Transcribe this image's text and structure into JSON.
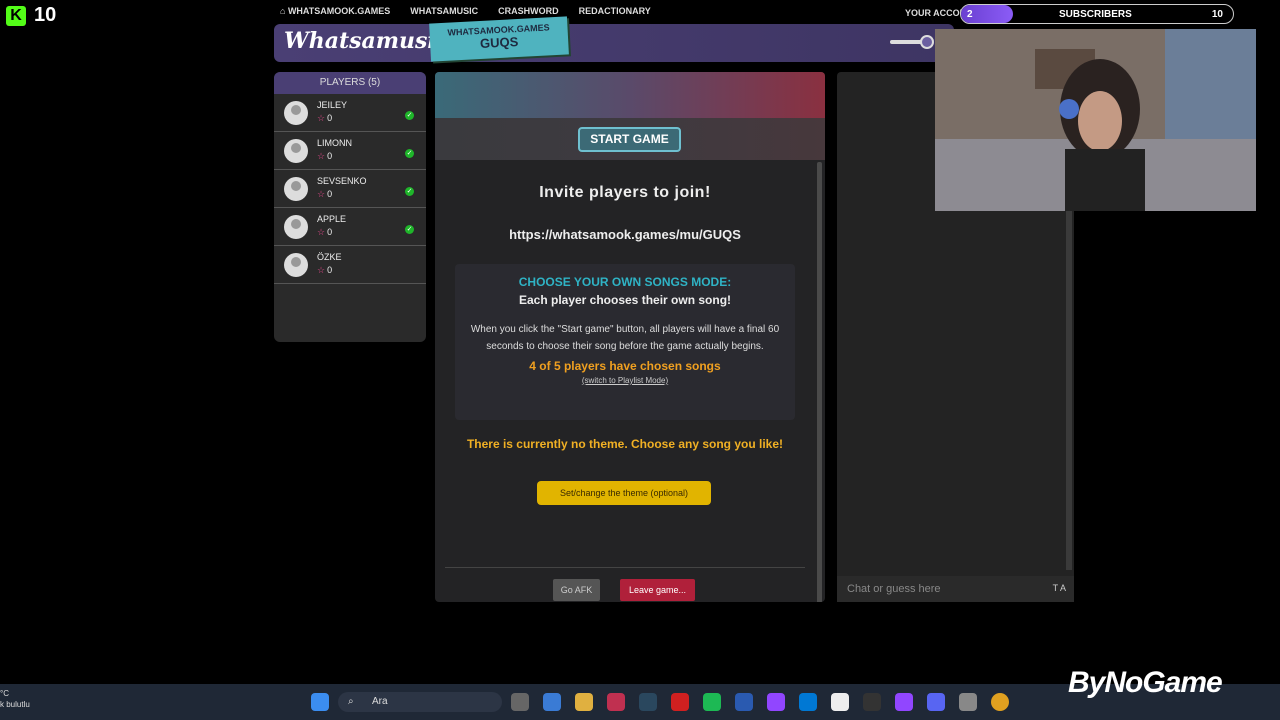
{
  "overlay": {
    "kick_count": "10",
    "subs_count": "2",
    "subs_label": "SUBSCRIBERS",
    "subs_goal": "10",
    "brand": "ByNoGame"
  },
  "topnav": {
    "items": [
      "WHATSAMOOK.GAMES",
      "WHATSAMUSIC",
      "CRASHWORD",
      "REDACTIONARY"
    ],
    "account": "YOUR ACCOU"
  },
  "header": {
    "logo": "Whatsamusic",
    "room_site": "WHATSAMOOK.GAMES",
    "room_code": "GUQS"
  },
  "players": {
    "title": "PLAYERS (5)",
    "list": [
      {
        "name": "JEILEY",
        "score": "0",
        "ready": true
      },
      {
        "name": "LIMONN",
        "score": "0",
        "ready": true
      },
      {
        "name": "SEVSENKO",
        "score": "0",
        "ready": true
      },
      {
        "name": "APPLE",
        "score": "0",
        "ready": true
      },
      {
        "name": "ÖZKE",
        "score": "0",
        "ready": false
      }
    ]
  },
  "main": {
    "start_label": "START GAME",
    "invite": "Invite players to join!",
    "url": "https://whatsamook.games/mu/GUQS",
    "mode_title": "CHOOSE YOUR OWN SONGS MODE:",
    "mode_subtitle": "Each player chooses their own song!",
    "mode_desc": "When you click the \"Start game\" button, all players will have a final 60 seconds to choose their song before the game actually begins.",
    "mode_status": "4 of 5 players have chosen songs",
    "mode_switch": "(switch to Playlist Mode)",
    "theme_text": "There is currently no theme. Choose any song you like!",
    "theme_button": "Set/change the theme (optional)",
    "afk_button": "Go AFK",
    "leave_button": "Leave game..."
  },
  "chat": {
    "placeholder": "Chat or guess here",
    "tools": "T A"
  },
  "taskbar": {
    "weather": "°C",
    "weather_sub": "k bulutlu",
    "search_label": "Ara"
  },
  "colors": {
    "accent_purple": "#4a3f74",
    "teal": "#4fb3bf",
    "orange": "#f0a020",
    "theme_yellow": "#e1b400",
    "leave_red": "#b0203a"
  }
}
